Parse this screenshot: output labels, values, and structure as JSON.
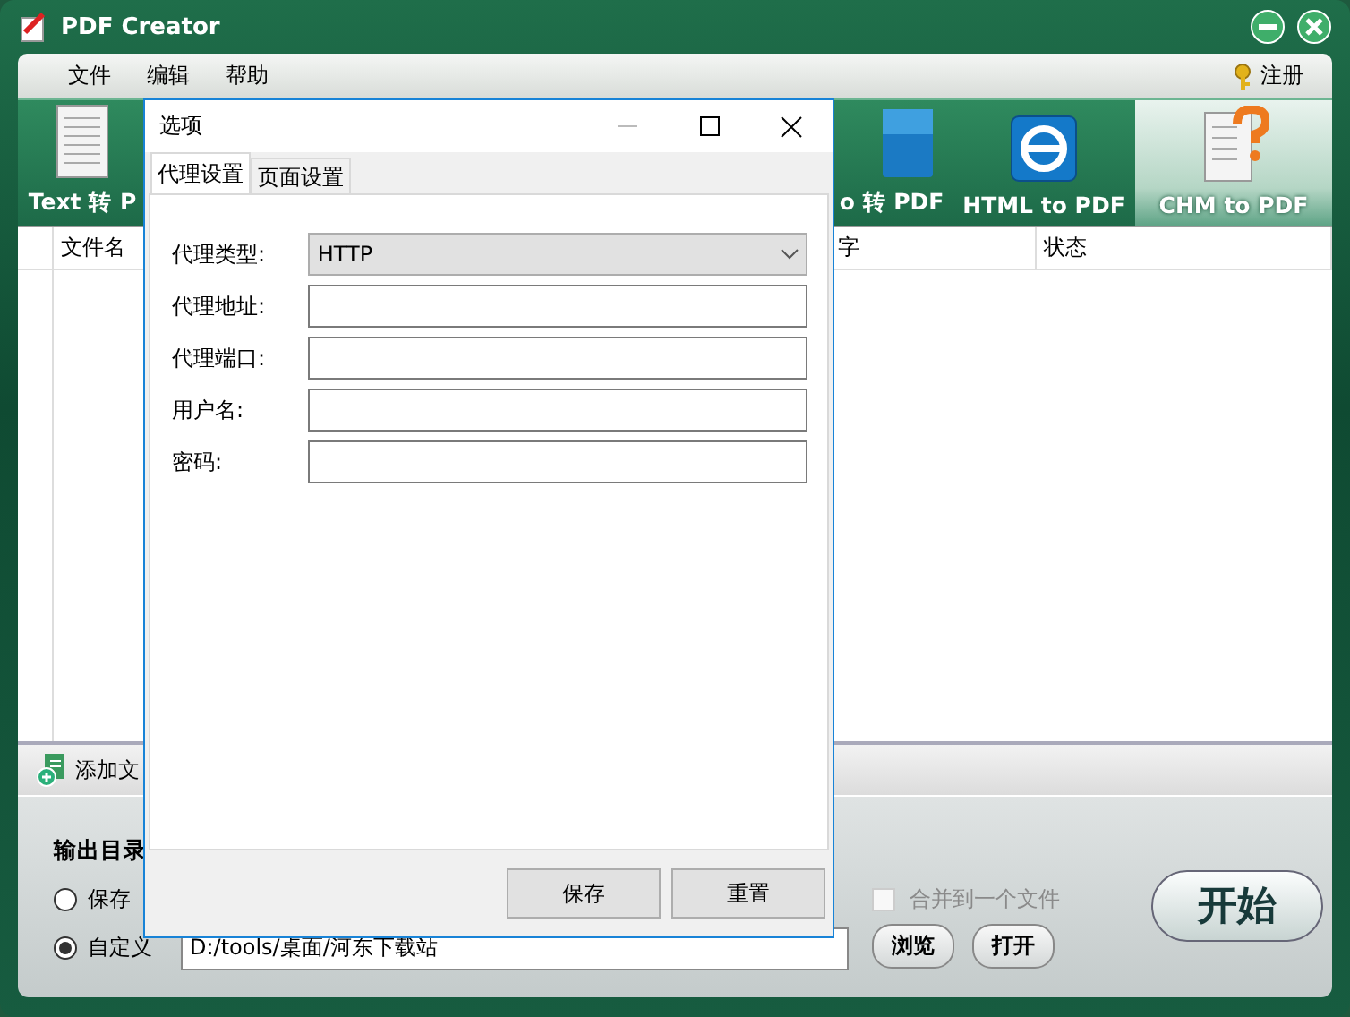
{
  "window": {
    "title": "PDF Creator"
  },
  "menu": [
    {
      "label": "文件"
    },
    {
      "label": "编辑"
    },
    {
      "label": "帮助"
    }
  ],
  "register": {
    "label": "注册"
  },
  "converters": [
    {
      "label": "Text 转 P",
      "kind": "text",
      "selected": false
    },
    {
      "label": "o 转 PDF",
      "kind": "epub",
      "selected": false
    },
    {
      "label": "HTML to PDF",
      "kind": "html",
      "selected": false
    },
    {
      "label": "CHM to PDF",
      "kind": "chm",
      "selected": true
    }
  ],
  "file_table": {
    "columns": [
      "文件名",
      "字",
      "状态"
    ]
  },
  "add_file": {
    "label": "添加文"
  },
  "output": {
    "title": "输出目录",
    "options": [
      {
        "label": "保存",
        "selected": false
      },
      {
        "label": "自定义",
        "selected": true
      }
    ],
    "path": "D:/tools/桌面/河东下载站",
    "merge": {
      "label": "合并到一个文件",
      "checked": false,
      "disabled": true
    },
    "buttons": [
      "浏览",
      "打开"
    ],
    "start": "开始"
  },
  "dialog": {
    "title": "选项",
    "tabs": [
      {
        "label": "代理设置",
        "selected": true
      },
      {
        "label": "页面设置",
        "selected": false
      }
    ],
    "fields": [
      {
        "label": "代理类型:",
        "kind": "select",
        "value": "HTTP"
      },
      {
        "label": "代理地址:",
        "kind": "text"
      },
      {
        "label": "代理端口:",
        "kind": "text"
      },
      {
        "label": "用户名:",
        "kind": "text"
      },
      {
        "label": "密码:",
        "kind": "password"
      }
    ],
    "buttons": [
      "保存",
      "重置"
    ]
  }
}
